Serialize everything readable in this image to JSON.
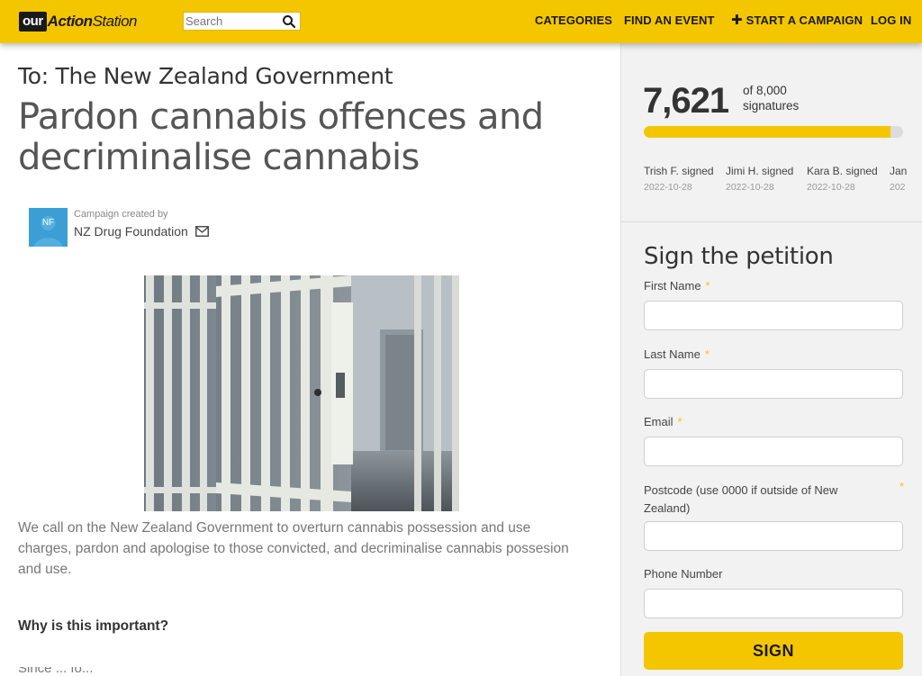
{
  "header": {
    "logo_our": "our",
    "logo_action": "Action",
    "logo_station": "Station",
    "search_placeholder": "Search",
    "nav": {
      "categories": "CATEGORIES",
      "find_event": "FIND AN EVENT",
      "start_campaign": "START A CAMPAIGN",
      "login": "LOG IN"
    },
    "brand_color": "#f4c600"
  },
  "petition": {
    "to": "To: The New Zealand Government",
    "title": "Pardon cannabis offences and decriminalise cannabis",
    "creator_label": "Campaign created by",
    "creator_initials": "NF",
    "creator_name": "NZ Drug Foundation",
    "summary": "We call on the New Zealand Government to overturn cannabis possession and use charges, pardon and apologise to those convicted, and decriminalise cannabis possesion and use.",
    "why_heading": "Why is this important?",
    "body_start": "Since ... fo..."
  },
  "signatures": {
    "count": "7,621",
    "goal_line1": "of 8,000",
    "goal_line2": "signatures",
    "progress_fraction": 0.9526,
    "recent": [
      {
        "name": "Trish F. signed",
        "date": "2022-10-28"
      },
      {
        "name": "Jimi H. signed",
        "date": "2022-10-28"
      },
      {
        "name": "Kara B. signed",
        "date": "2022-10-28"
      },
      {
        "name": "Jan",
        "date": "202"
      }
    ]
  },
  "form": {
    "title": "Sign the petition",
    "first_name": "First Name",
    "last_name": "Last Name",
    "email": "Email",
    "postcode_line1": "Postcode (use 0000 if outside of New",
    "postcode_line2": "Zealand)",
    "phone": "Phone Number",
    "required_mark": "*",
    "submit": "SIGN"
  }
}
